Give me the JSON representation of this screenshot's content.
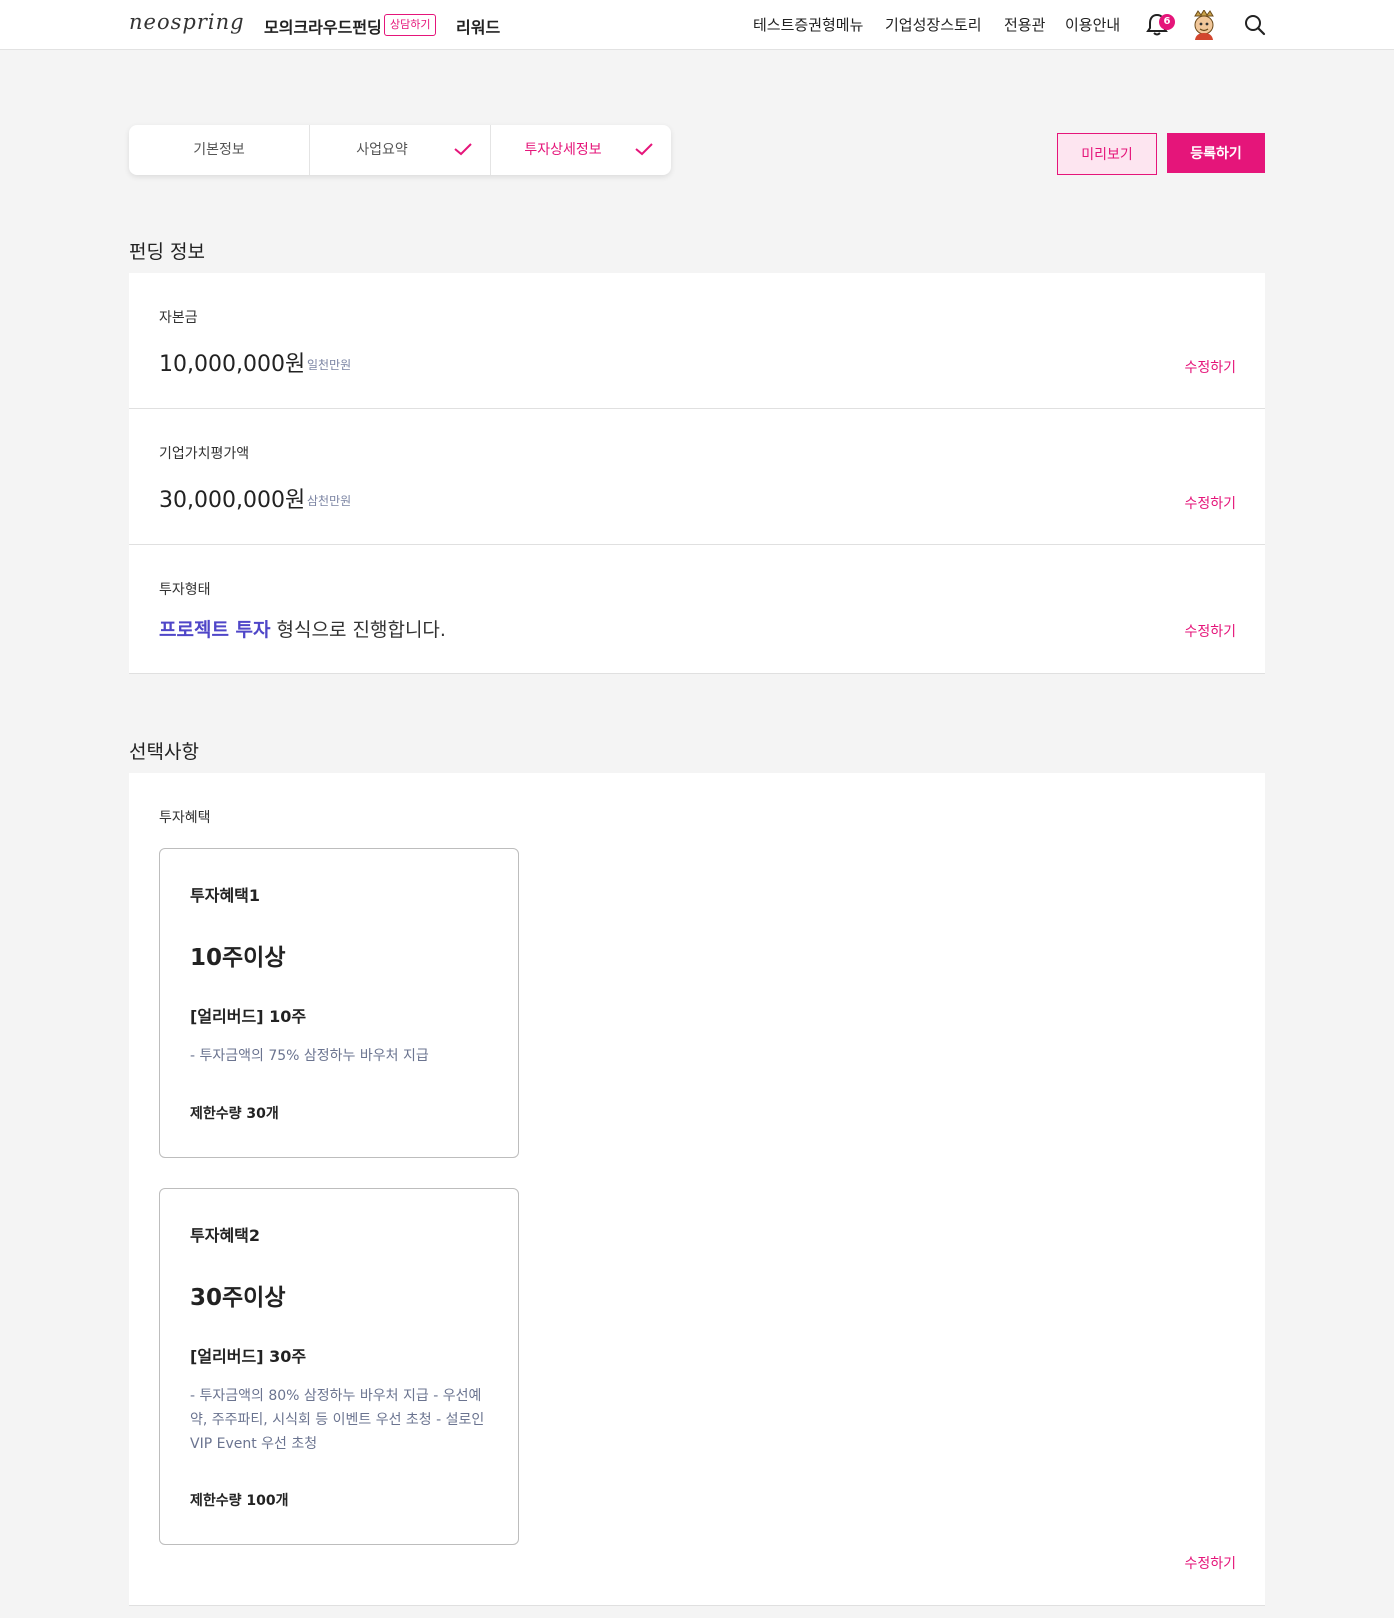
{
  "header": {
    "logo": "neospring",
    "main_nav": "모의크라우드펀딩",
    "consult_badge": "상담하기",
    "reward_nav": "리워드",
    "right_nav": [
      "테스트증권형메뉴",
      "기업성장스토리",
      "전용관",
      "이용안내"
    ],
    "notification_count": "6"
  },
  "steps": [
    {
      "label": "기본정보",
      "checked": false,
      "active": false
    },
    {
      "label": "사업요약",
      "checked": true,
      "active": false
    },
    {
      "label": "투자상세정보",
      "checked": true,
      "active": true
    }
  ],
  "actions": {
    "preview_label": "미리보기",
    "register_label": "등록하기"
  },
  "funding": {
    "title": "펀딩 정보",
    "capital": {
      "label": "자본금",
      "value": "10,000,000원",
      "sub": "일천만원",
      "edit": "수정하기"
    },
    "valuation": {
      "label": "기업가치평가액",
      "value": "30,000,000원",
      "sub": "삼천만원",
      "edit": "수정하기"
    },
    "invest_type": {
      "label": "투자형태",
      "highlight": "프로젝트 투자",
      "rest": " 형식으로 진행합니다.",
      "edit": "수정하기"
    }
  },
  "options": {
    "title": "선택사항",
    "benefits_label": "투자혜택",
    "edit": "수정하기",
    "benefits": [
      {
        "name": "투자혜택1",
        "min": "10주이상",
        "title": "[얼리버드] 10주",
        "desc": "- 투자금액의 75% 삼정하누 바우처 지급",
        "limit": "제한수량 30개"
      },
      {
        "name": "투자혜택2",
        "min": "30주이상",
        "title": "[얼리버드] 30주",
        "desc": "- 투자금액의 80% 삼정하누 바우처 지급 - 우선예약, 주주파티, 시식회 등 이벤트 우선 초청 - 설로인 VIP Event 우선 초청",
        "limit": "제한수량 100개"
      }
    ]
  },
  "colors": {
    "accent": "#e5157a",
    "highlight": "#4f46c8",
    "sub_text": "#7b84a3"
  }
}
